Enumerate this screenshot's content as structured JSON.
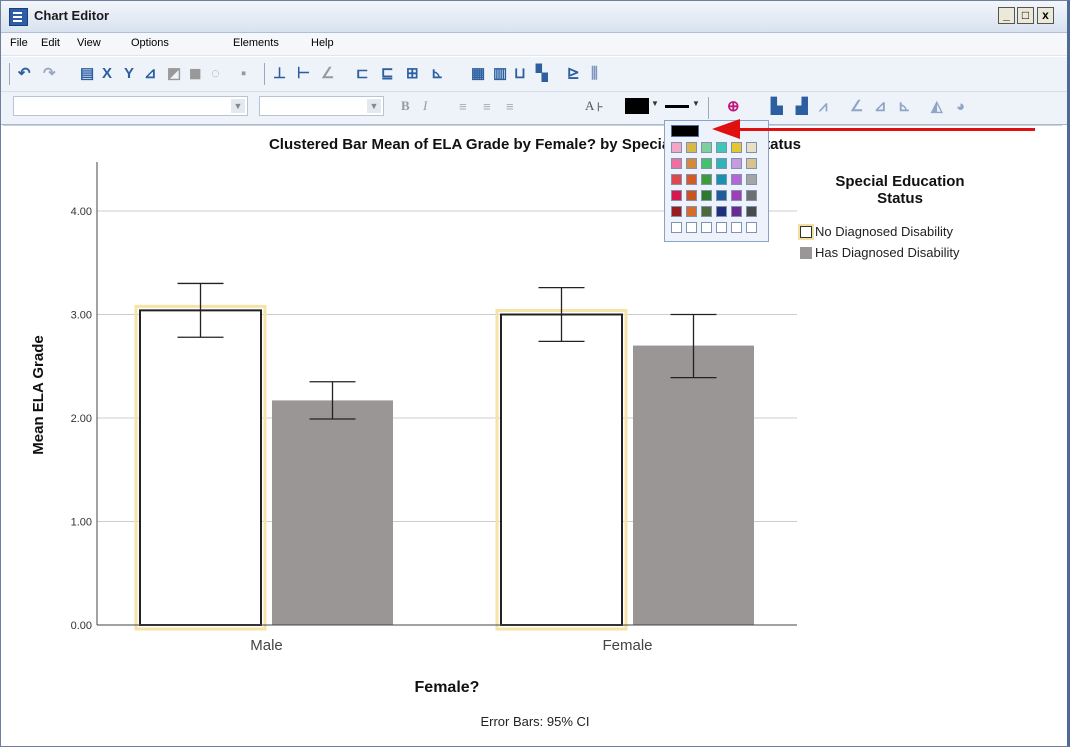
{
  "window": {
    "title": "Chart Editor",
    "min_glyph": "_",
    "max_glyph": "□",
    "close_glyph": "x"
  },
  "menu": {
    "items": [
      "File",
      "Edit",
      "View",
      "Options",
      "Elements",
      "Help"
    ]
  },
  "format_bar": {
    "bold_glyph": "B",
    "italic_glyph": "I",
    "text_glyph": "A"
  },
  "chart": {
    "title": "Clustered Bar Mean of ELA Grade by Female? by Special Education Status",
    "caption": "Error Bars: 95% CI",
    "legend": {
      "title_line1": "Special Education",
      "title_line2": "Status",
      "items": [
        {
          "label": "No Diagnosed Disability",
          "color": "#ffffff"
        },
        {
          "label": "Has Diagnosed Disability",
          "color": "#9b9696"
        }
      ]
    }
  },
  "chart_data": {
    "type": "bar",
    "title": "Clustered Bar Mean of ELA Grade by Female? by Special Education Status",
    "xlabel": "Female?",
    "ylabel": "Mean ELA Grade",
    "categories": [
      "Male",
      "Female"
    ],
    "ylim": [
      0,
      4.5
    ],
    "yticks": [
      "0.00",
      "1.00",
      "2.00",
      "3.00",
      "4.00"
    ],
    "grid": true,
    "legend_position": "right",
    "series": [
      {
        "name": "No Diagnosed Disability",
        "color": "#ffffff",
        "values": [
          3.04,
          3.0
        ],
        "ci_low": [
          2.78,
          2.74
        ],
        "ci_high": [
          3.3,
          3.26
        ]
      },
      {
        "name": "Has Diagnosed Disability",
        "color": "#9b9696",
        "values": [
          2.17,
          2.7
        ],
        "ci_low": [
          1.99,
          2.39
        ],
        "ci_high": [
          2.35,
          3.0
        ]
      }
    ]
  },
  "palette": {
    "selected_color": "#000000",
    "colors": [
      [
        "#f4a6c8",
        "#d9b84a",
        "#7ecf9a",
        "#3fc7b8",
        "#e6c52e",
        "#e8e0c4"
      ],
      [
        "#ef6fa1",
        "#d48a3a",
        "#44c26a",
        "#30b4b8",
        "#c79be0",
        "#d8c38e"
      ],
      [
        "#e0474a",
        "#d45b28",
        "#3c9d3c",
        "#1d8fb0",
        "#b367d6",
        "#a5a5a5"
      ],
      [
        "#d9174f",
        "#c9541d",
        "#2e7b2e",
        "#1f5c9a",
        "#9e3fb8",
        "#6e6e6e"
      ],
      [
        "#9b1c1c",
        "#d66b2a",
        "#4e6a3a",
        "#1f2f7a",
        "#6a2a8f",
        "#4a4a4a"
      ],
      [
        "#ffffff",
        "#ffffff",
        "#ffffff",
        "#ffffff",
        "#ffffff",
        "#ffffff"
      ]
    ]
  }
}
